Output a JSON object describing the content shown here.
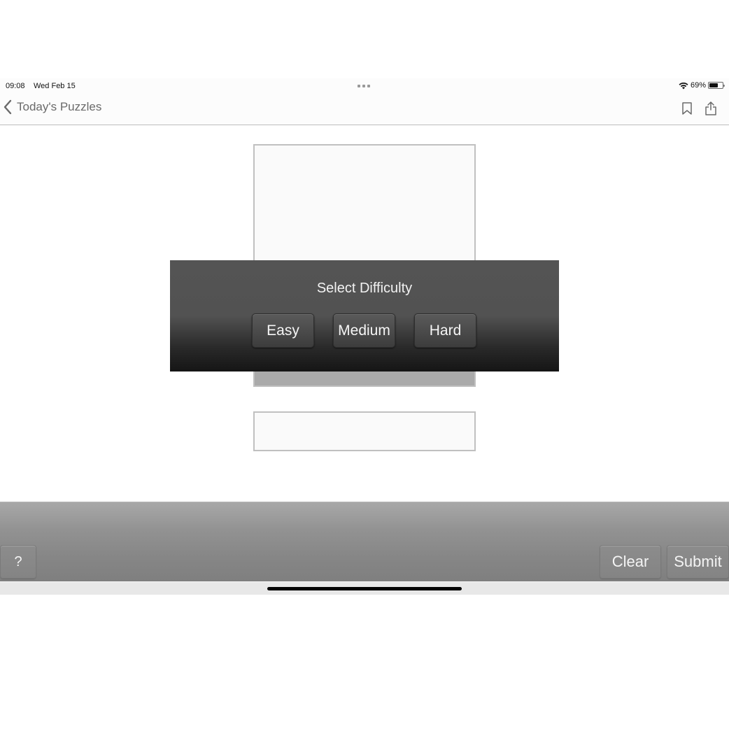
{
  "status_bar": {
    "time": "09:08",
    "date": "Wed Feb 15",
    "battery_percent_label": "69%",
    "battery_level": 0.69,
    "icons": [
      "wifi-icon",
      "battery-icon",
      "multitask-dots-icon"
    ]
  },
  "nav": {
    "back_label": "Today's Puzzles",
    "icons": [
      "chevron-left-icon",
      "bookmark-icon",
      "share-icon"
    ]
  },
  "dialog": {
    "title": "Select Difficulty",
    "options": [
      {
        "label": "Easy"
      },
      {
        "label": "Medium"
      },
      {
        "label": "Hard"
      }
    ]
  },
  "toolbar": {
    "help_label": "?",
    "clear_label": "Clear",
    "submit_label": "Submit"
  }
}
